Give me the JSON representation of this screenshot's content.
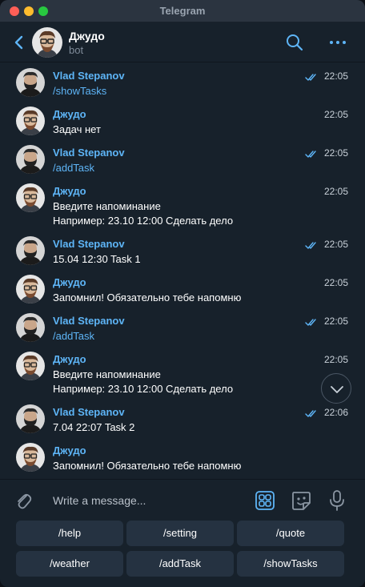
{
  "window": {
    "title": "Telegram"
  },
  "header": {
    "name": "Джудо",
    "subtitle": "bot"
  },
  "messages": [
    {
      "sender": "Vlad Stepanov",
      "lines": [
        "/showTasks"
      ],
      "time": "22:05",
      "outgoing": true,
      "command": true,
      "avatar": "vlad"
    },
    {
      "sender": "Джудо",
      "lines": [
        "Задач нет"
      ],
      "time": "22:05",
      "outgoing": false,
      "command": false,
      "avatar": "bot"
    },
    {
      "sender": "Vlad Stepanov",
      "lines": [
        "/addTask"
      ],
      "time": "22:05",
      "outgoing": true,
      "command": true,
      "avatar": "vlad"
    },
    {
      "sender": "Джудо",
      "lines": [
        "Введите напоминание",
        "Например: 23.10 12:00 Сделать дело"
      ],
      "time": "22:05",
      "outgoing": false,
      "command": false,
      "avatar": "bot"
    },
    {
      "sender": "Vlad Stepanov",
      "lines": [
        "15.04 12:30 Task 1"
      ],
      "time": "22:05",
      "outgoing": true,
      "command": false,
      "avatar": "vlad"
    },
    {
      "sender": "Джудо",
      "lines": [
        "Запомнил! Обязательно тебе напомню"
      ],
      "time": "22:05",
      "outgoing": false,
      "command": false,
      "avatar": "bot"
    },
    {
      "sender": "Vlad Stepanov",
      "lines": [
        "/addTask"
      ],
      "time": "22:05",
      "outgoing": true,
      "command": true,
      "avatar": "vlad"
    },
    {
      "sender": "Джудо",
      "lines": [
        "Введите напоминание",
        "Например: 23.10 12:00 Сделать дело"
      ],
      "time": "22:05",
      "outgoing": false,
      "command": false,
      "avatar": "bot"
    },
    {
      "sender": "Vlad Stepanov",
      "lines": [
        "7.04 22:07 Task 2"
      ],
      "time": "22:06",
      "outgoing": true,
      "command": false,
      "avatar": "vlad"
    },
    {
      "sender": "Джудо",
      "lines": [
        "Запомнил! Обязательно тебе напомню"
      ],
      "time": "",
      "outgoing": false,
      "command": false,
      "avatar": "bot"
    }
  ],
  "composer": {
    "placeholder": "Write a message..."
  },
  "keyboard": {
    "rows": [
      [
        "/help",
        "/setting",
        "/quote"
      ],
      [
        "/weather",
        "/addTask",
        "/showTasks"
      ]
    ]
  },
  "icons": {
    "back": "chevron-left-icon",
    "search": "search-icon",
    "more": "more-dots-icon",
    "attach": "paperclip-icon",
    "keyboard": "bot-keyboard-icon",
    "sticker": "sticker-icon",
    "mic": "microphone-icon",
    "scroll": "chevron-down-icon",
    "read": "double-check-icon"
  },
  "colors": {
    "background": "#17212b",
    "accent": "#5eb5f7",
    "button": "#253241",
    "text": "#ffffff",
    "muted": "#7f8b99"
  }
}
